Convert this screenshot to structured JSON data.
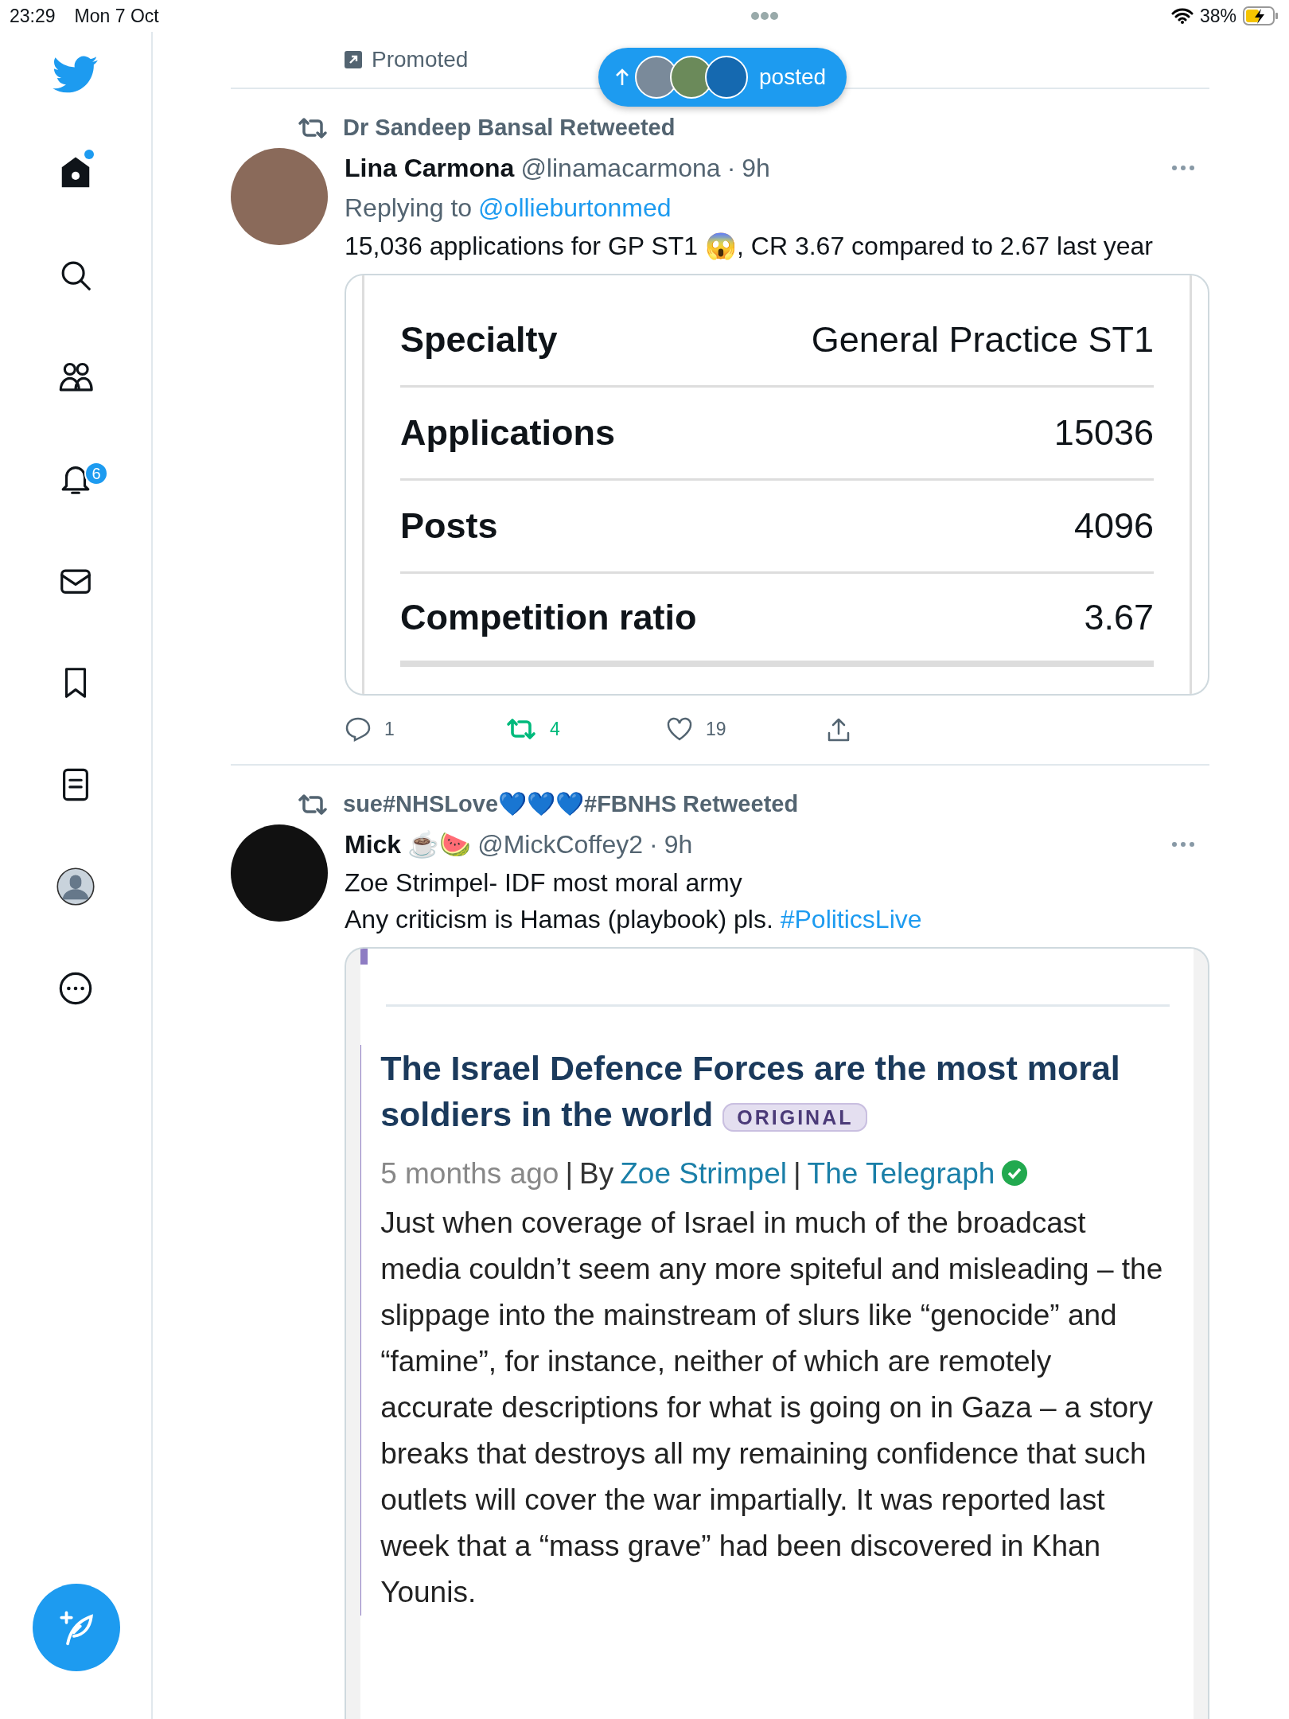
{
  "status_bar": {
    "time": "23:29",
    "date": "Mon 7 Oct",
    "battery": "38%",
    "charging": true
  },
  "sidebar": {
    "items": [
      {
        "kind": "home",
        "selected": true,
        "has_new": true
      },
      {
        "kind": "search",
        "selected": false,
        "has_new": false
      },
      {
        "kind": "communities",
        "selected": false,
        "has_new": false
      },
      {
        "kind": "notifications",
        "selected": false,
        "has_new": false,
        "badge": "6"
      },
      {
        "kind": "messages",
        "selected": false,
        "has_new": false
      },
      {
        "kind": "bookmarks",
        "selected": false,
        "has_new": false
      },
      {
        "kind": "lists",
        "selected": false,
        "has_new": false
      },
      {
        "kind": "profile",
        "selected": false,
        "has_new": false
      },
      {
        "kind": "more",
        "selected": false,
        "has_new": false
      }
    ]
  },
  "promoted": {
    "label": "Promoted"
  },
  "new_posts_pill": {
    "label": "posted"
  },
  "tweets": [
    {
      "retweeted_by": "Dr Sandeep Bansal Retweeted",
      "name": "Lina Carmona",
      "handle": "@linamacarmona",
      "separator": "·",
      "time": "9h",
      "replying_label": "Replying to",
      "replying_to": "@ollieburtonmed",
      "text": [
        [
          {
            "kind": "plain",
            "text": "15,036 applications for GP ST1 😱, CR 3.67 compared to 2.67 last year"
          }
        ]
      ],
      "embed": {
        "kind": "table",
        "rows": [
          {
            "label": "Specialty",
            "value": "General Practice ST1"
          },
          {
            "label": "Applications",
            "value": "15036"
          },
          {
            "label": "Posts",
            "value": "4096"
          },
          {
            "label": "Competition ratio",
            "value": "3.67"
          }
        ]
      },
      "actions": {
        "replies": "1",
        "retweets": "4",
        "likes": "19",
        "retweeted": true
      }
    },
    {
      "retweeted_by": "sue#NHSLove💙💙💙#FBNHS Retweeted",
      "name": "Mick",
      "name_emoji": "☕️🍉",
      "handle": "@MickCoffey2",
      "separator": "·",
      "time": "9h",
      "text": [
        [
          {
            "kind": "plain",
            "text": "Zoe Strimpel- IDF most moral army"
          }
        ],
        [
          {
            "kind": "plain",
            "text": "Any criticism is Hamas (playbook) pls. "
          },
          {
            "kind": "link",
            "text": "#PoliticsLive"
          }
        ]
      ],
      "embed": {
        "kind": "article",
        "title": "The Israel Defence Forces are the most moral soldiers in the world",
        "tag": "ORIGINAL",
        "age": "5 months ago",
        "separator_1": "|",
        "by": "By",
        "separator_2": "|",
        "author": "Zoe Strimpel",
        "source": "The Telegraph",
        "verified": true,
        "body": "Just when coverage of Israel in much of the broadcast media couldn’t seem any more spiteful and misleading – the slippage into the mainstream of slurs like “genocide” and “famine”, for instance, neither of which are remotely accurate descriptions for what is going on in Gaza – a story breaks that destroys all my remaining confidence that such outlets will cover the war impartially. It was reported last week that a “mass grave” had been discovered in Khan Younis."
      }
    }
  ]
}
